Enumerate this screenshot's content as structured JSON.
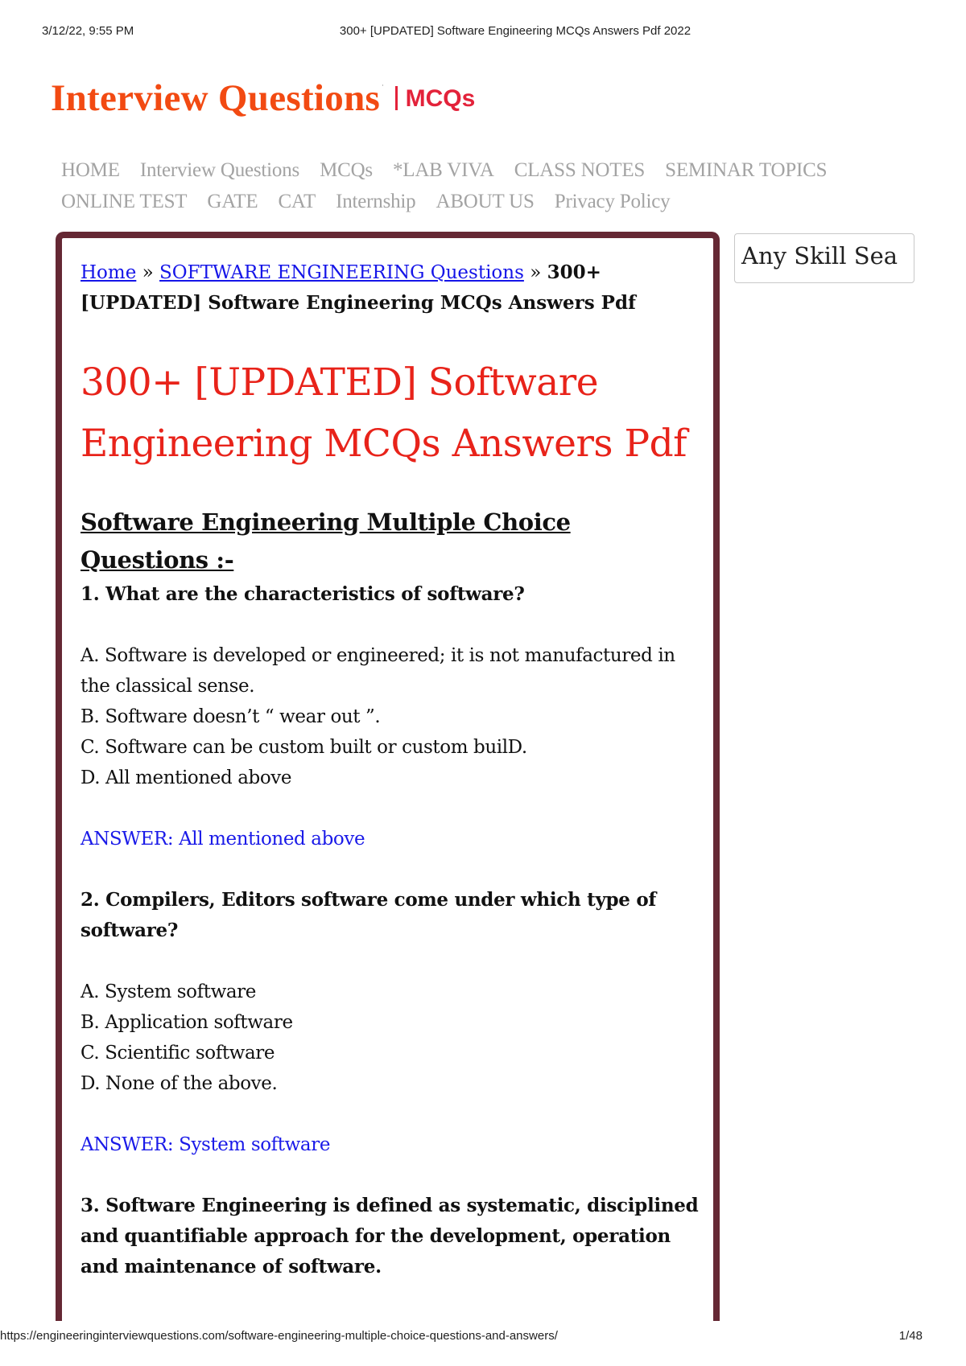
{
  "print_header": {
    "date": "3/12/22, 9:55 PM",
    "doc_title": "300+ [UPDATED] Software Engineering MCQs Answers Pdf 2022"
  },
  "print_footer": {
    "url": "https://engineeringinterviewquestions.com/software-engineering-multiple-choice-questions-and-answers/",
    "page": "1/48"
  },
  "logo": {
    "brand": "Interview Questions",
    "tm": "·",
    "sub": "MCQs",
    "brand_color": "#f24a12",
    "sub_color": "#e3223a"
  },
  "nav": {
    "row1": [
      "HOME",
      "Interview Questions",
      "MCQs",
      "*LAB VIVA",
      "CLASS NOTES",
      "SEMINAR TOPICS"
    ],
    "row2": [
      "ONLINE TEST",
      "GATE",
      "CAT",
      "Internship",
      "ABOUT US",
      "Privacy Policy"
    ]
  },
  "search": {
    "value": "Any Skill Sea"
  },
  "breadcrumb": {
    "home": "Home",
    "separator": "»",
    "category": "SOFTWARE ENGINEERING Questions",
    "current": "300+ [UPDATED] Software Engineering MCQs Answers Pdf"
  },
  "article": {
    "title": "300+ [UPDATED] Software Engineering MCQs Answers Pdf",
    "section_heading": "Software Engineering Multiple Choice Questions :-",
    "questions": [
      {
        "question": "1. What are the characteristics of software?",
        "options": [
          "A. Software is developed or engineered; it is not manufactured in the classical sense.",
          "B. Software doesn’t “ wear out ”.",
          "C. Software can be custom built or custom builD.",
          "D. All mentioned above"
        ],
        "answer": "ANSWER: All mentioned above"
      },
      {
        "question": "2. Compilers, Editors software come under which type of software?",
        "options": [
          "A. System software",
          "B. Application software",
          "C. Scientific software",
          "D. None of the above."
        ],
        "answer": "ANSWER: System software"
      },
      {
        "question": "3. Software Engineering is defined as systematic, disciplined and quantifiable approach for the development, operation and maintenance of software."
      }
    ]
  },
  "colors": {
    "box_border": "#652834",
    "title_red": "#e8231a",
    "link_blue": "#1515e8",
    "answer_blue": "#1a1ae8",
    "nav_gray": "#a3a3a3"
  }
}
